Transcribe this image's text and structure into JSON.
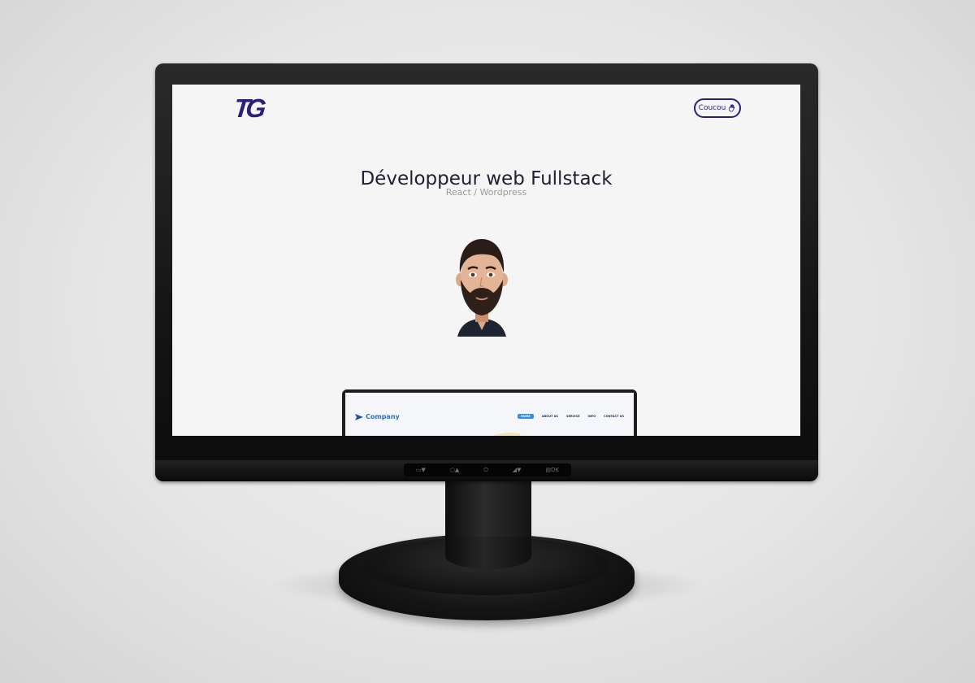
{
  "site": {
    "logo_text": "TG",
    "header_button_label": "Coucou",
    "header_button_icon": "waving-hand-icon",
    "hero_title": "Développeur web Fullstack",
    "hero_subtitle": "React / Wordpress",
    "avatar_icon": "bearded-man-avatar-icon",
    "brand_color": "#2b1f78"
  },
  "preview_site": {
    "brand_name": "Company",
    "brand_icon": "paper-plane-icon",
    "nav_items": [
      {
        "label": "HOME",
        "active": true
      },
      {
        "label": "ABOUT US",
        "active": false
      },
      {
        "label": "SERVICE",
        "active": false
      },
      {
        "label": "INFO",
        "active": false
      },
      {
        "label": "CONTACT US",
        "active": false
      }
    ],
    "accent_color": "#3a8be0"
  },
  "monitor": {
    "control_labels": [
      "▭▼",
      "○▲",
      "⏻",
      "◢▼",
      "▤OK"
    ]
  }
}
